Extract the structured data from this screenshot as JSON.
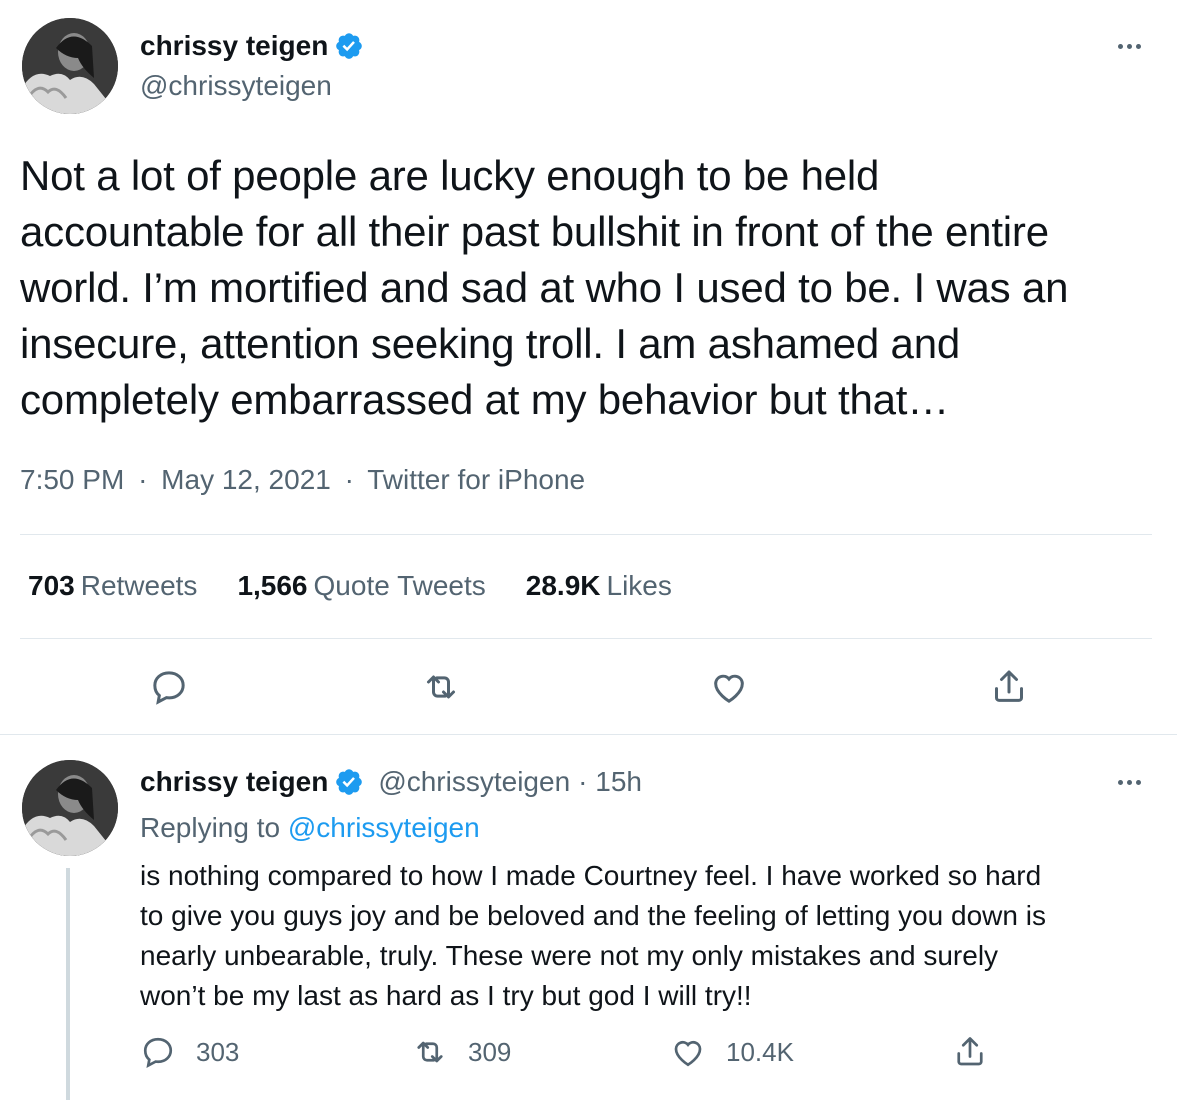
{
  "colors": {
    "accent": "#1d9bf0",
    "text": "#0f1419",
    "muted": "#536471",
    "border": "#e1e8ed"
  },
  "tweet": {
    "author": {
      "name": "chrissy teigen",
      "handle": "@chrissyteigen",
      "verified_icon": "verified-badge-icon"
    },
    "text": "Not a lot of people are lucky enough to be held\naccountable for all their past bullshit in front of the entire\nworld. I’m mortified and sad at who I used to be. I was an\ninsecure, attention seeking troll. I am ashamed and\ncompletely embarrassed at my behavior but that…",
    "time": "7:50 PM",
    "date": "May 12, 2021",
    "source": "Twitter for iPhone",
    "separator": "·",
    "stats": [
      {
        "value": "703",
        "label": "Retweets"
      },
      {
        "value": "1,566",
        "label": "Quote Tweets"
      },
      {
        "value": "28.9K",
        "label": "Likes"
      }
    ],
    "actions": [
      "reply-icon",
      "retweet-icon",
      "like-icon",
      "share-icon"
    ]
  },
  "reply": {
    "author": {
      "name": "chrissy teigen",
      "handle": "@chrissyteigen",
      "age": "· 15h"
    },
    "replying_prefix": "Replying to",
    "replying_handle": "@chrissyteigen",
    "text": "is nothing compared to how I made Courtney feel. I have worked so hard\nto give you guys joy and be beloved and the feeling of letting you down is\nnearly unbearable, truly. These were not my only mistakes and surely\nwon’t be my last as hard as I try but god I will try!!",
    "reply_count": "303",
    "retweet_count": "309",
    "like_count": "10.4K"
  }
}
